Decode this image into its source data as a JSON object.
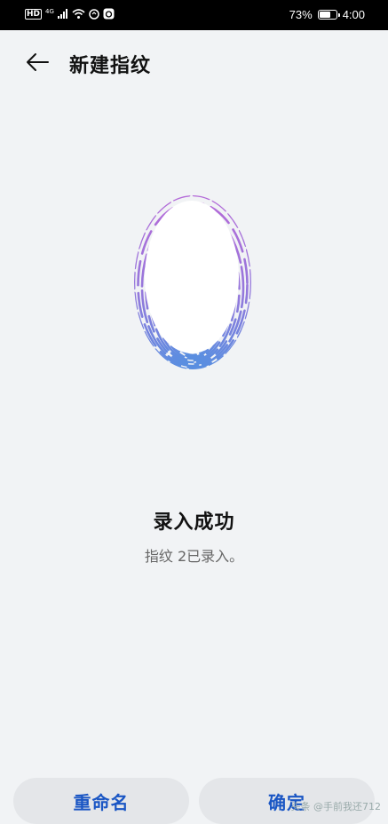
{
  "status_bar": {
    "hd": "HD",
    "network": "4G",
    "battery_percent": "73%",
    "battery_level": 0.73,
    "time": "4:00",
    "icons": [
      "hd-icon",
      "signal-icon",
      "wifi-icon",
      "data-saver-icon",
      "app-notification-icon",
      "battery-icon"
    ]
  },
  "header": {
    "title": "新建指纹",
    "back_icon": "back-arrow-icon"
  },
  "result": {
    "title": "录入成功",
    "description": "指纹 2已录入。"
  },
  "buttons": {
    "rename": "重命名",
    "confirm": "确定"
  },
  "watermark": "头条 @手前我还712",
  "colors": {
    "accent": "#1a56c4",
    "fingerprint_top": "#b46ad8",
    "fingerprint_bottom": "#5a8ee0",
    "background": "#f1f3f5"
  }
}
